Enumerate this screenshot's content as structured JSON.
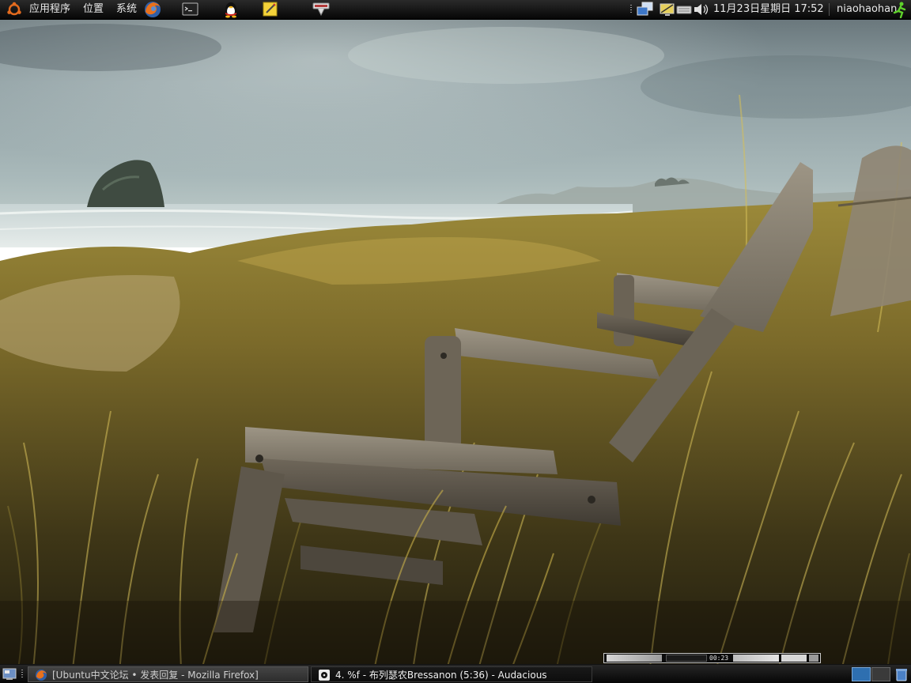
{
  "top_panel": {
    "menus": [
      {
        "label": "应用程序",
        "icon": "ubuntu-logo-icon"
      },
      {
        "label": "位置"
      },
      {
        "label": "系统"
      }
    ],
    "launchers": [
      "firefox-icon",
      "terminal-icon",
      "qq-penguin-icon",
      "notes-icon",
      "router-icon"
    ],
    "tray_icons": [
      "network-icon",
      "display-icon",
      "keyboard-icon",
      "volume-icon"
    ],
    "clock": "11月23日星期日 17:52",
    "user": "niaohaohan",
    "logout_icon": "running-man-icon"
  },
  "bottom_panel": {
    "show_desktop_icon": "show-desktop-icon",
    "tasks": [
      {
        "label": "[Ubuntu中文论坛 • 发表回复 - Mozilla Firefox]",
        "icon": "firefox-icon",
        "state": "minimized"
      },
      {
        "label": "4. %f - 布列瑟农Bressanon (5:36) - Audacious",
        "icon": "audacious-icon",
        "state": "active"
      }
    ],
    "workspaces": 2,
    "active_workspace": 1,
    "trash_icon": "trash-icon"
  },
  "audacious_mini": {
    "time": "00:23",
    "controls": [
      "previous",
      "play",
      "pause",
      "stop",
      "next",
      "eject"
    ]
  },
  "colors": {
    "panel_bg": "#0c0c0c",
    "panel_text": "#e8e8e8",
    "workspace_active": "#2e6fb0",
    "workspace_inactive": "#3a3a3a"
  }
}
